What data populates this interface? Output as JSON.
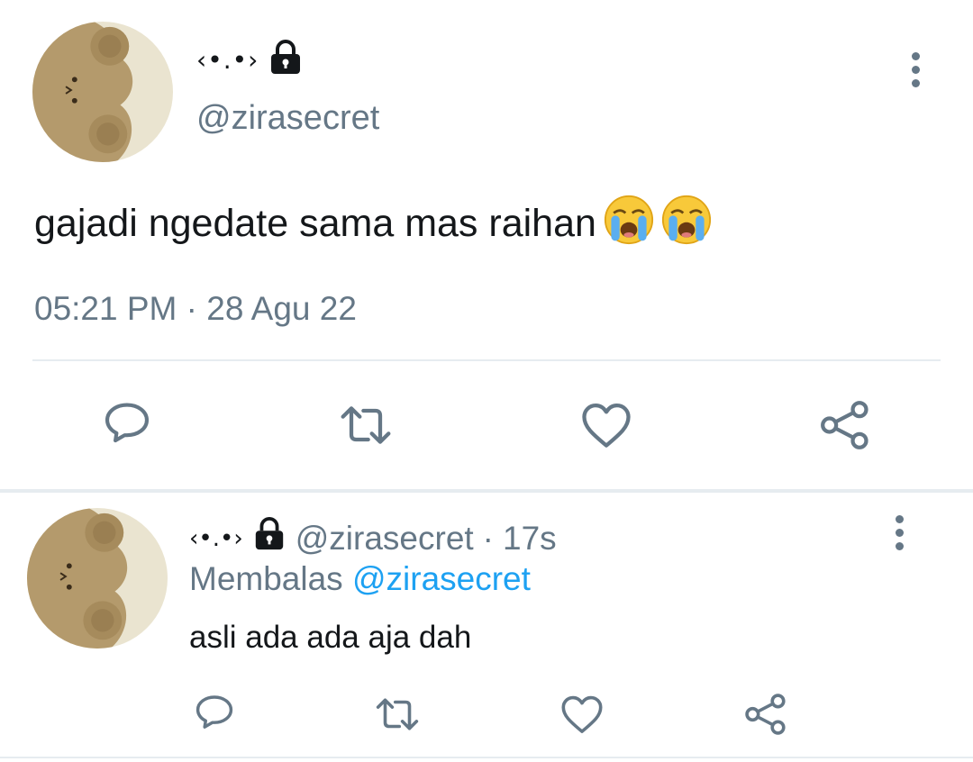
{
  "tweet": {
    "display_name": "‹•.•›",
    "handle": "@zirasecret",
    "text": "gajadi ngedate sama mas raihan",
    "emojis": [
      "loudly-crying-face",
      "loudly-crying-face"
    ],
    "time": "05:21 PM",
    "separator": "·",
    "date": "28 Agu 22",
    "avatar": "bear-avatar",
    "menu_icon": "more-vertical-icon"
  },
  "actions": [
    {
      "icon": "reply-icon"
    },
    {
      "icon": "retweet-icon"
    },
    {
      "icon": "like-icon"
    },
    {
      "icon": "share-icon"
    }
  ],
  "reply": {
    "display_name": "‹•.•›",
    "handle": "@zirasecret",
    "separator": "·",
    "age": "17s",
    "replying_prefix": "Membalas",
    "replying_to": "@zirasecret",
    "text": "asli ada ada aja dah"
  },
  "colors": {
    "text": "#14171a",
    "secondary": "#657786",
    "link": "#1da1f2",
    "divider": "#e6ecf0"
  }
}
